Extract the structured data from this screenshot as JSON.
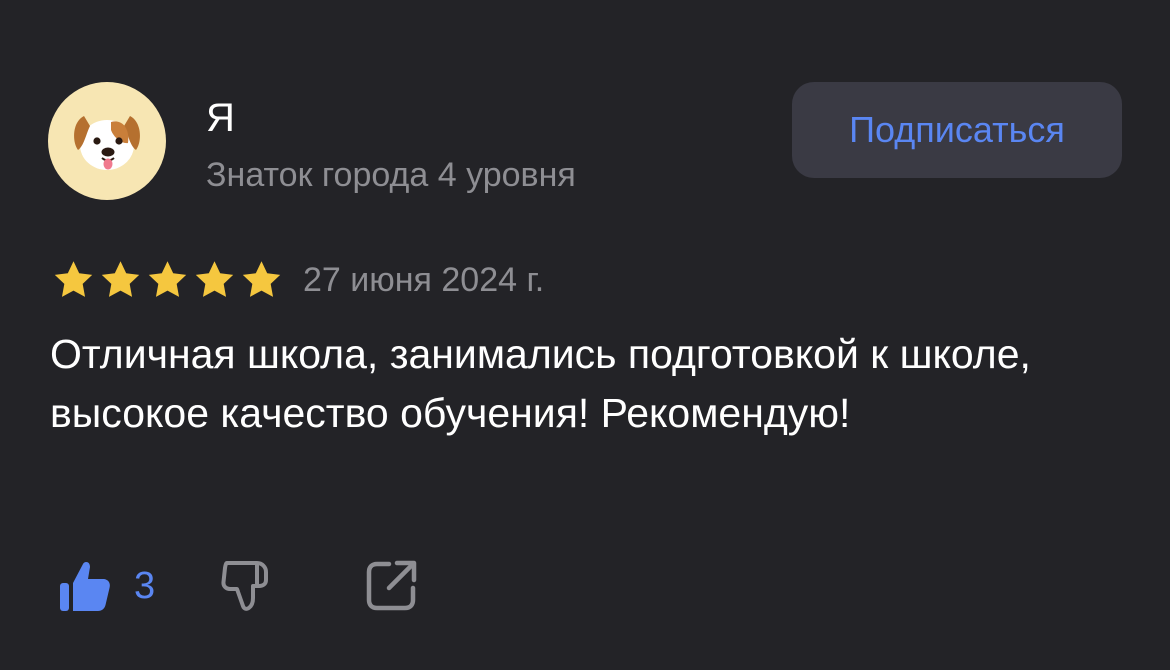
{
  "review": {
    "author": {
      "name": "Я",
      "level": "Знаток города 4 уровня",
      "avatar_icon": "puppy-face-icon"
    },
    "subscribe_label": "Подписаться",
    "rating": 5,
    "rating_max": 5,
    "date": "27 июня 2024 г.",
    "text": "Отличная школа, занимались подготовкой к школе, высокое качество обучения! Рекомендую!",
    "likes": "3",
    "icons": {
      "like": "thumbs-up-icon",
      "dislike": "thumbs-down-icon",
      "share": "share-icon",
      "star": "star-icon"
    },
    "colors": {
      "background": "#232327",
      "accent": "#5a86f2",
      "star": "#f5c73f",
      "muted_text": "#8e8e93",
      "button_bg": "#3a3a44",
      "avatar_bg": "#f7e6b3"
    }
  }
}
